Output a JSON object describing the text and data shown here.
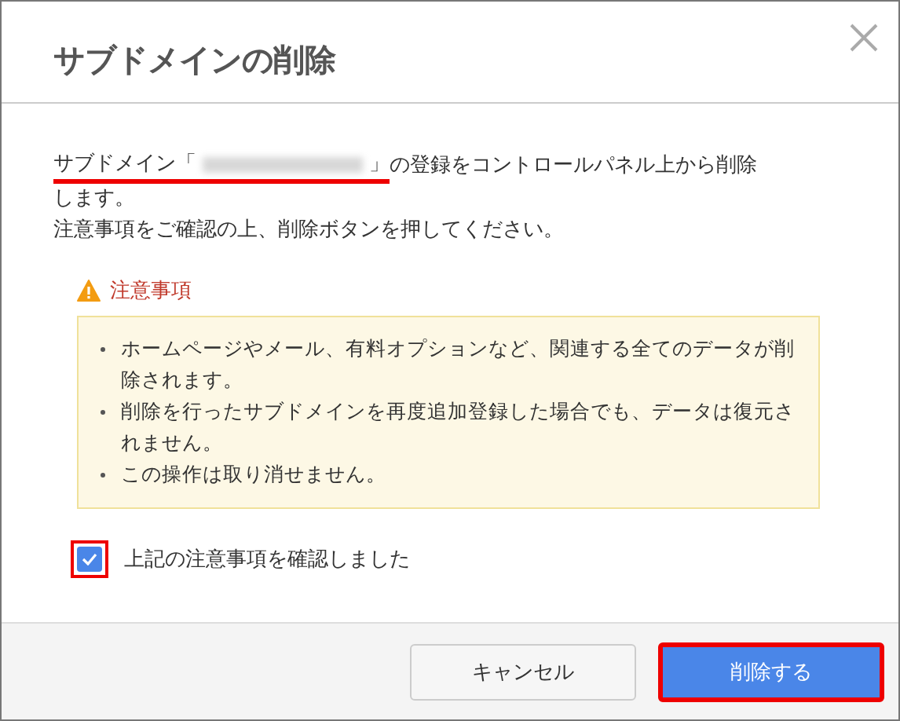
{
  "dialog": {
    "title": "サブドメインの削除"
  },
  "intro": {
    "prefix": "サブドメイン「",
    "closing": "」",
    "rest": "の登録をコントロールパネル上から削除",
    "line2": "します。",
    "line3": "注意事項をご確認の上、削除ボタンを押してください。",
    "underlined": true
  },
  "caution": {
    "heading": "注意事項",
    "items": [
      "ホームページやメール、有料オプションなど、関連する全てのデータが削除されます。",
      "削除を行ったサブドメインを再度追加登録した場合でも、データは復元されません。",
      "この操作は取り消せません。"
    ]
  },
  "confirm": {
    "label": "上記の注意事項を確認しました",
    "checked": true,
    "highlighted": true
  },
  "buttons": [
    {
      "kind": "cancel",
      "label": "キャンセル",
      "highlighted": false
    },
    {
      "kind": "primary",
      "label": "削除する",
      "highlighted": true
    }
  ]
}
